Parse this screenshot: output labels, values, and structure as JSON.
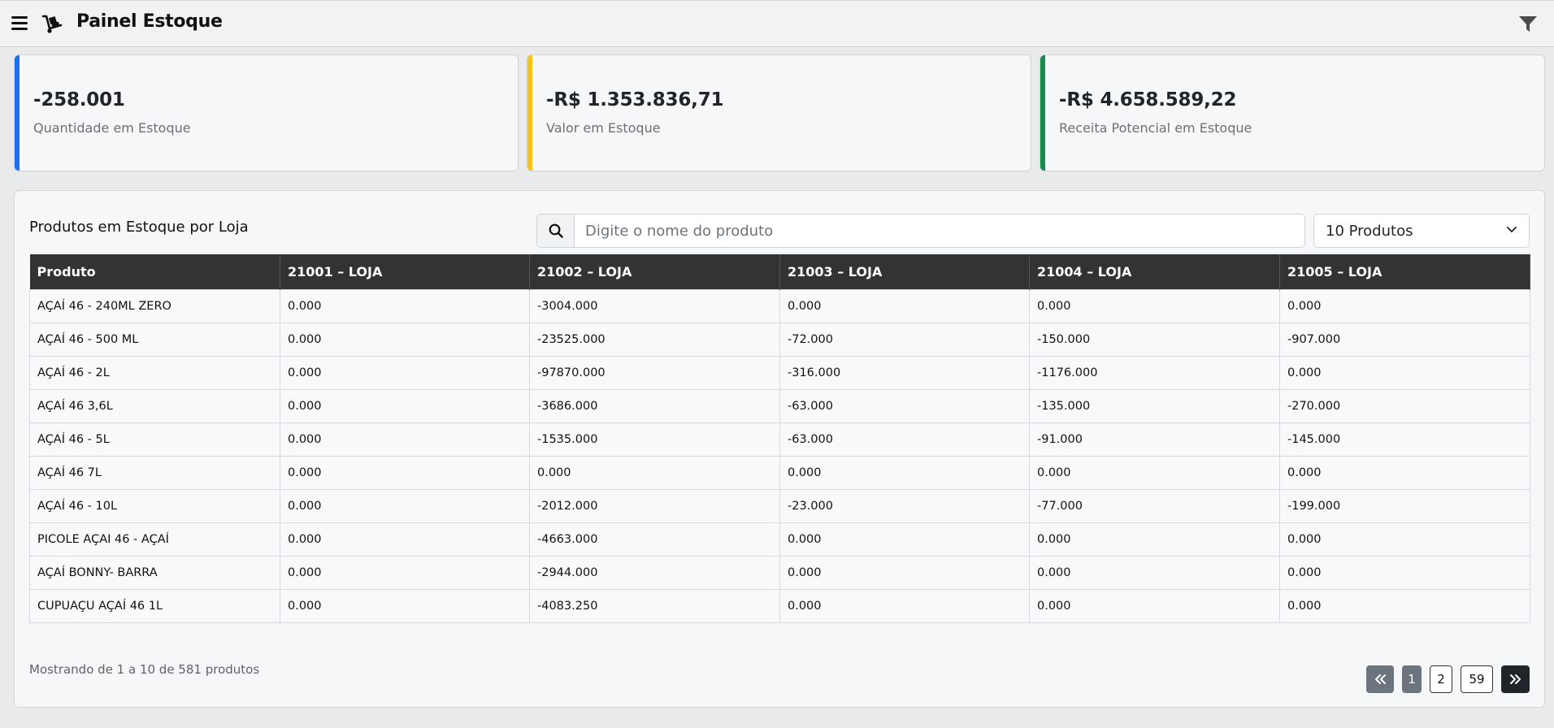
{
  "header": {
    "title": "Painel Estoque"
  },
  "kpis": [
    {
      "value": "-258.001",
      "label": "Quantidade em Estoque",
      "color": "#1e6ff0"
    },
    {
      "value": "-R$ 1.353.836,71",
      "label": "Valor em Estoque",
      "color": "#f5c218"
    },
    {
      "value": "-R$ 4.658.589,22",
      "label": "Receita Potencial em Estoque",
      "color": "#188a4c"
    }
  ],
  "panel": {
    "title": "Produtos em Estoque por Loja",
    "search_placeholder": "Digite o nome do produto",
    "page_size": "10 Produtos"
  },
  "table": {
    "headers": [
      "Produto",
      "21001 – LOJA",
      "21002 – LOJA",
      "21003 – LOJA",
      "21004 – LOJA",
      "21005 – LOJA"
    ],
    "rows": [
      [
        "AÇAÍ 46 - 240ML ZERO",
        "0.000",
        "-3004.000",
        "0.000",
        "0.000",
        "0.000"
      ],
      [
        "AÇAÍ 46 - 500 ML",
        "0.000",
        "-23525.000",
        "-72.000",
        "-150.000",
        "-907.000"
      ],
      [
        "AÇAÍ 46 - 2L",
        "0.000",
        "-97870.000",
        "-316.000",
        "-1176.000",
        "0.000"
      ],
      [
        "AÇAÍ 46 3,6L",
        "0.000",
        "-3686.000",
        "-63.000",
        "-135.000",
        "-270.000"
      ],
      [
        "AÇAÍ 46 - 5L",
        "0.000",
        "-1535.000",
        "-63.000",
        "-91.000",
        "-145.000"
      ],
      [
        "AÇAÍ 46 7L",
        "0.000",
        "0.000",
        "0.000",
        "0.000",
        "0.000"
      ],
      [
        "AÇAÍ 46 - 10L",
        "0.000",
        "-2012.000",
        "-23.000",
        "-77.000",
        "-199.000"
      ],
      [
        "PICOLE AÇAI 46 - AÇAÍ",
        "0.000",
        "-4663.000",
        "0.000",
        "0.000",
        "0.000"
      ],
      [
        "AÇAÍ BONNY- BARRA",
        "0.000",
        "-2944.000",
        "0.000",
        "0.000",
        "0.000"
      ],
      [
        "CUPUAÇU AÇAÍ 46 1L",
        "0.000",
        "-4083.250",
        "0.000",
        "0.000",
        "0.000"
      ]
    ]
  },
  "footer": {
    "summary": "Mostrando de 1 a 10 de 581 produtos",
    "pages": [
      "1",
      "2",
      "59"
    ]
  },
  "icons": {
    "menu": "hamburger-icon",
    "logo": "hand-truck-icon",
    "filter": "funnel-filter-icon",
    "search": "search-icon",
    "page_size": "chevron-down-icon",
    "first": "double-chevron-left-icon",
    "last": "double-chevron-right-icon"
  }
}
